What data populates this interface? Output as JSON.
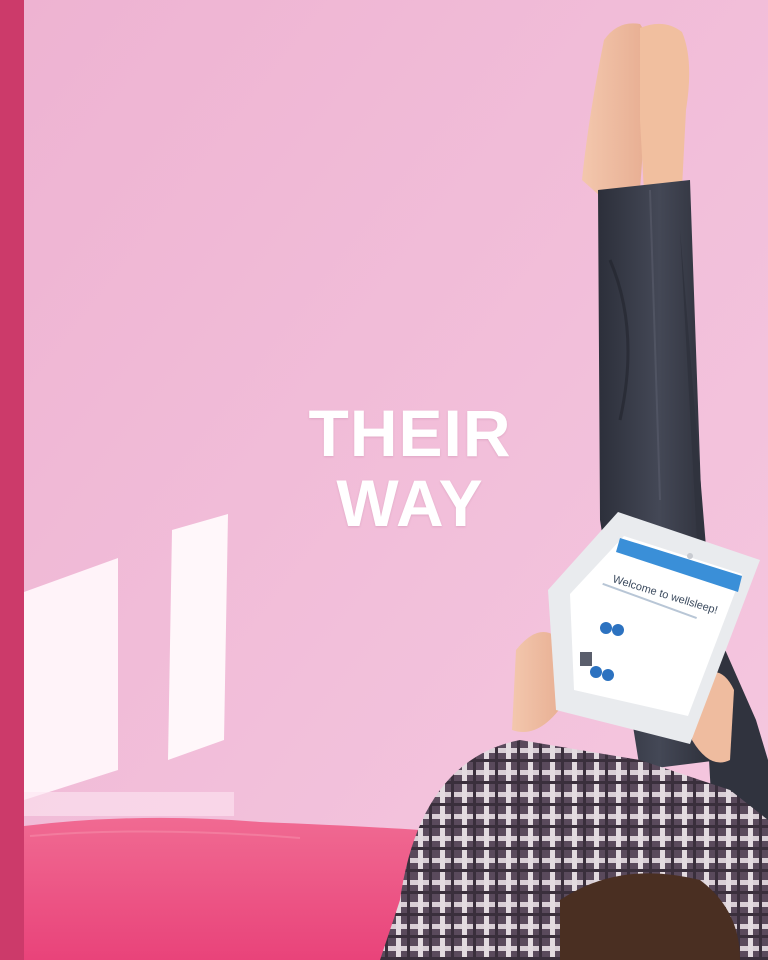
{
  "headline": {
    "line1": "THEIR",
    "line2": "WAY"
  },
  "tablet_screen": {
    "title": "Welcome to wellsleep!"
  },
  "colors": {
    "accent_bar": "#cc3a6a",
    "wall": "#f3bfd9",
    "bed": "#ee5b86",
    "headline_text": "#ffffff",
    "tablet_header": "#3a8fd8"
  }
}
